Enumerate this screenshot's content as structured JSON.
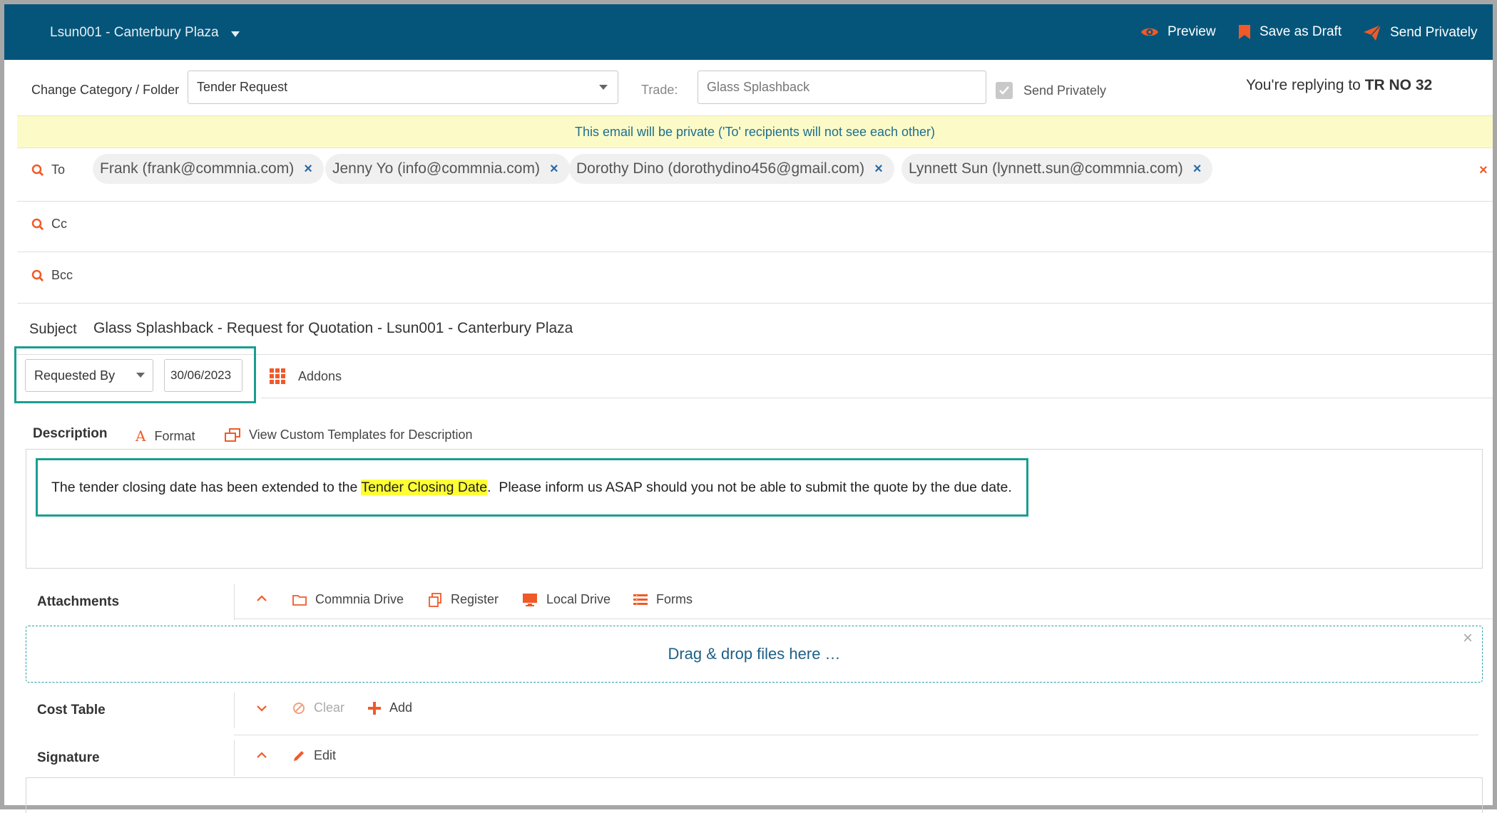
{
  "header": {
    "project": "Lsun001 - Canterbury Plaza",
    "preview": "Preview",
    "save_draft": "Save as Draft",
    "send_privately": "Send Privately"
  },
  "category": {
    "label": "Change Category / Folder",
    "value": "Tender Request",
    "trade_label": "Trade:",
    "trade_value": "Glass Splashback",
    "send_privately_label": "Send Privately",
    "send_privately_checked": true,
    "replying_prefix": "You're replying to",
    "replying_ref": "TR NO 32"
  },
  "banner": "This email will be private ('To' recipients will not see each other)",
  "recipients": {
    "to_label": "To",
    "cc_label": "Cc",
    "bcc_label": "Bcc",
    "to": [
      "Frank (frank@commnia.com)",
      "Jenny Yo (info@commnia.com)",
      "Dorothy Dino (dorothydino456@gmail.com)",
      "Lynnett Sun (lynnett.sun@commnia.com)"
    ]
  },
  "subject": {
    "label": "Subject",
    "value": "Glass Splashback - Request for Quotation - Lsun001 - Canterbury Plaza"
  },
  "date_row": {
    "select": "Requested By",
    "date": "30/06/2023",
    "addons": "Addons"
  },
  "description": {
    "label": "Description",
    "format": "Format",
    "templates": "View Custom Templates for Description",
    "text_before": "The tender closing date has been extended to the ",
    "highlight": "Tender Closing Date",
    "text_after": ".  Please inform us ASAP should you not be able to submit the quote by the due date."
  },
  "attachments": {
    "label": "Attachments",
    "commnia_drive": "Commnia Drive",
    "register": "Register",
    "local_drive": "Local Drive",
    "forms": "Forms",
    "dropzone": "Drag & drop files here …"
  },
  "cost_table": {
    "label": "Cost Table",
    "clear": "Clear",
    "add": "Add"
  },
  "signature": {
    "label": "Signature",
    "edit": "Edit"
  },
  "colors": {
    "topbar": "#05557a",
    "accent": "#f05a28",
    "teal_highlight": "#1a9e8f",
    "banner": "#fcfbc8"
  }
}
